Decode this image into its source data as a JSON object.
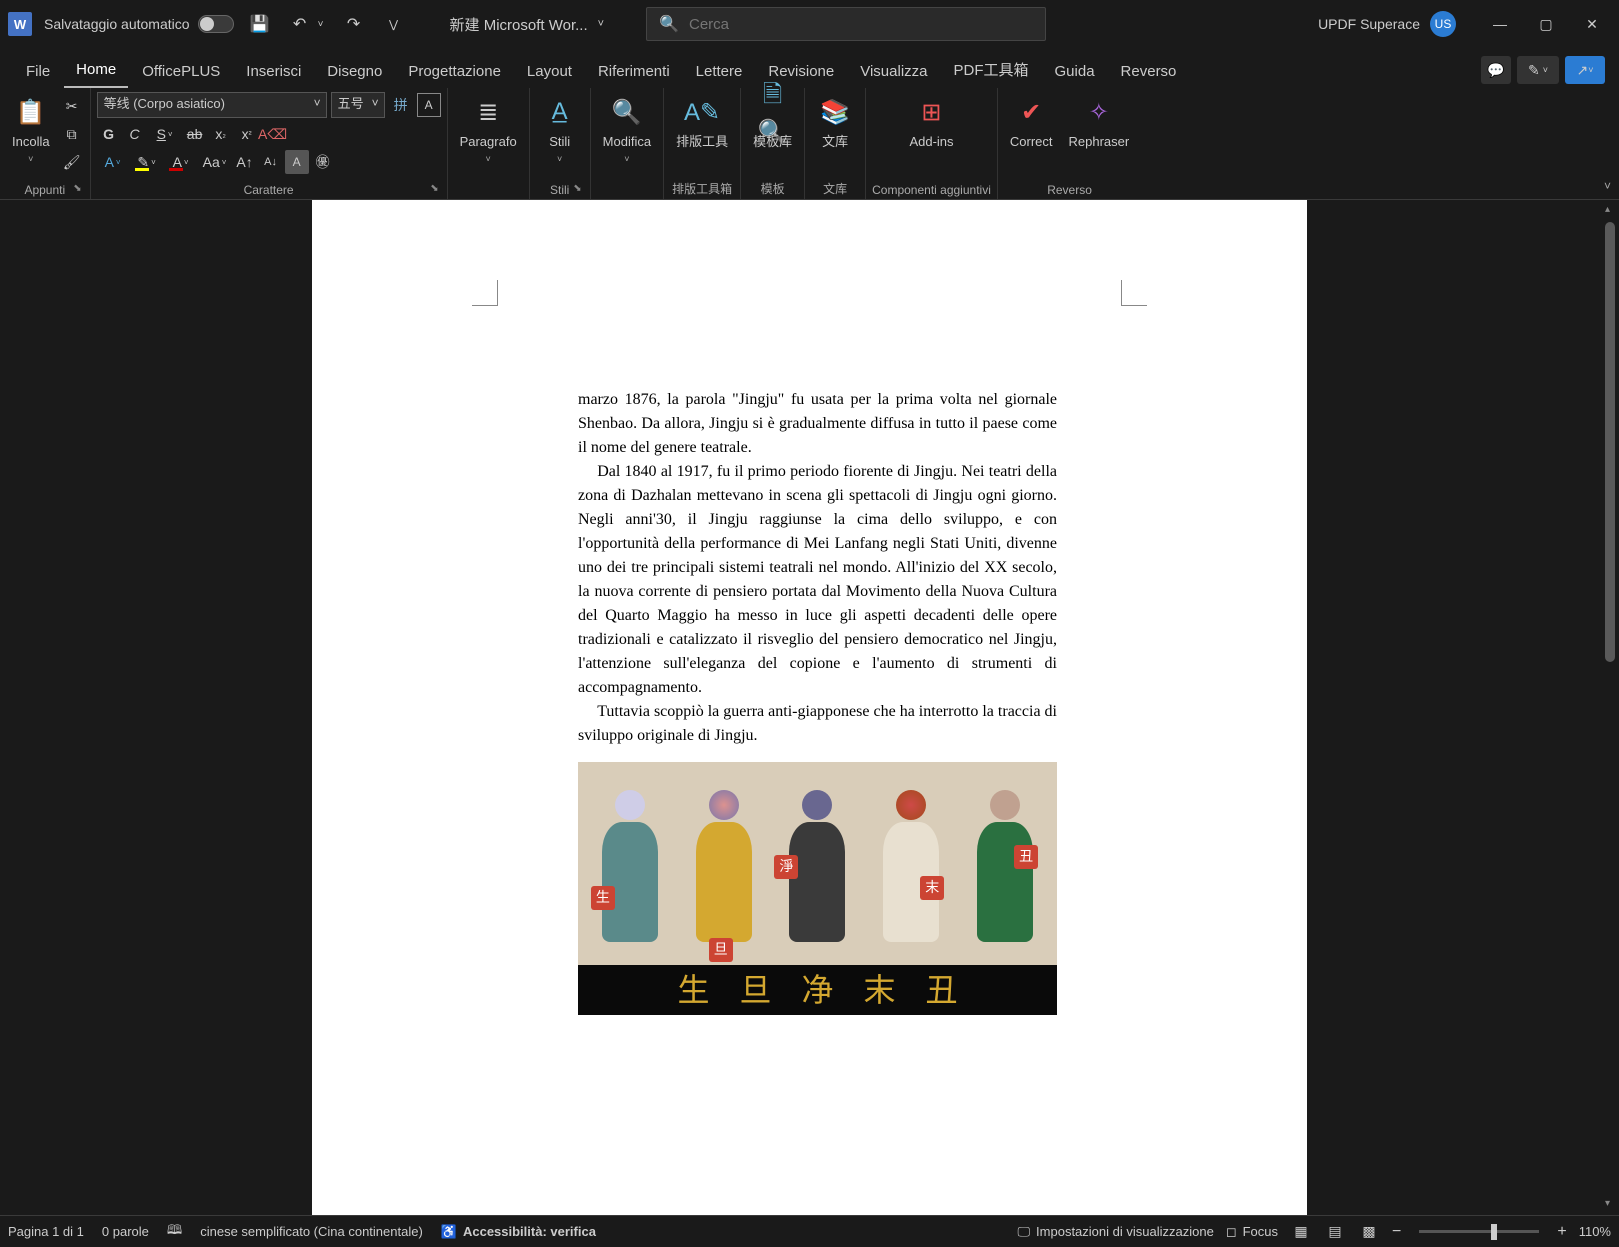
{
  "titlebar": {
    "autosave_label": "Salvataggio automatico",
    "doc_title": "新建 Microsoft Wor...",
    "search_placeholder": "Cerca",
    "user_name": "UPDF Superace",
    "avatar_initials": "US"
  },
  "tabs": {
    "items": [
      "File",
      "Home",
      "OfficePLUS",
      "Inserisci",
      "Disegno",
      "Progettazione",
      "Layout",
      "Riferimenti",
      "Lettere",
      "Revisione",
      "Visualizza",
      "PDF工具箱",
      "Guida",
      "Reverso"
    ],
    "active_index": 1
  },
  "ribbon": {
    "clipboard": {
      "paste": "Incolla",
      "group": "Appunti"
    },
    "font": {
      "font_name": "等线 (Corpo asiatico)",
      "font_size": "五号",
      "group": "Carattere"
    },
    "paragraph": {
      "label": "Paragrafo"
    },
    "styles": {
      "label": "Stili",
      "group": "Stili"
    },
    "edit": {
      "label": "Modifica"
    },
    "paiban": {
      "label": "排版工具",
      "group": "排版工具箱"
    },
    "mobanku": {
      "label": "模板库",
      "group": "模板"
    },
    "wenku": {
      "label": "文库",
      "group": "文库"
    },
    "addins": {
      "label": "Add-ins",
      "group": "Componenti aggiuntivi"
    },
    "reverso": {
      "correct": "Correct",
      "rephraser": "Rephraser",
      "group": "Reverso"
    }
  },
  "document": {
    "para1": "marzo 1876, la parola \"Jingju\" fu usata per la prima volta nel giornale Shenbao. Da allora, Jingju si è gradualmente diffusa in tutto il paese come il nome del genere teatrale.",
    "para2": "Dal 1840 al 1917, fu il primo periodo fiorente di Jingju. Nei teatri della zona di Dazhalan mettevano in scena gli spettacoli di Jingju ogni giorno. Negli anni'30, il Jingju raggiunse la cima dello sviluppo, e con l'opportunità della performance di Mei Lanfang negli Stati Uniti, divenne uno dei tre principali sistemi teatrali nel mondo. All'inizio del XX secolo, la nuova corrente di pensiero portata dal Movimento della Nuova Cultura del Quarto Maggio ha messo in luce gli aspetti decadenti delle opere tradizionali e catalizzato il risveglio del pensiero democratico nel Jingju, l'attenzione sull'eleganza del copione e l'aumento di strumenti di accompagnamento.",
    "para3": "Tuttavia scoppiò la guerra anti-giapponese che ha interrotto la traccia di sviluppo originale di Jingju.",
    "fig_tags": [
      "生",
      "旦",
      "淨",
      "末",
      "丑"
    ],
    "fig_chars": [
      "生",
      "旦",
      "净",
      "末",
      "丑"
    ]
  },
  "statusbar": {
    "page": "Pagina 1 di 1",
    "words": "0 parole",
    "lang": "cinese semplificato (Cina continentale)",
    "accessibility": "Accessibilità: verifica",
    "display_settings": "Impostazioni di visualizzazione",
    "focus": "Focus",
    "zoom": "110%"
  }
}
